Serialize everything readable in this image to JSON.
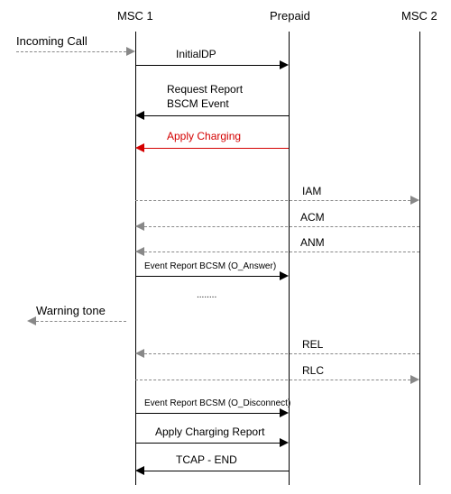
{
  "participants": {
    "msc1": "MSC 1",
    "prepaid": "Prepaid",
    "msc2": "MSC 2"
  },
  "external": {
    "incoming": "Incoming Call",
    "warning": "Warning tone"
  },
  "messages": {
    "initialdp": "InitialDP",
    "req_report_l1": "Request Report",
    "req_report_l2": "BSCM Event",
    "apply_charging": "Apply Charging",
    "iam": "IAM",
    "acm": "ACM",
    "anm": "ANM",
    "evt_answer": "Event Report BCSM (O_Answer)",
    "ellipsis": "........",
    "rel": "REL",
    "rlc": "RLC",
    "evt_disconnect": "Event Report BCSM (O_Disconnect)",
    "apply_report": "Apply Charging Report",
    "tcap_end": "TCAP - END"
  }
}
